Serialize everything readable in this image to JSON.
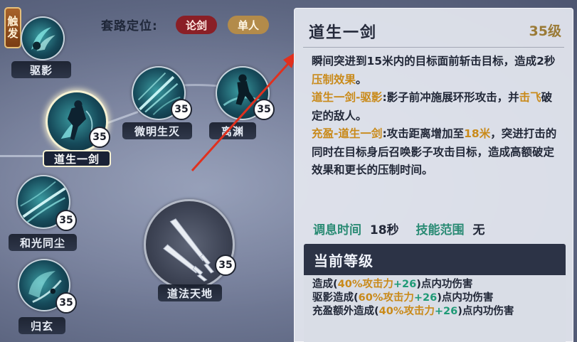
{
  "trigger_label": "触发",
  "route": {
    "label": "套路定位:",
    "tags": [
      "论剑",
      "单人"
    ]
  },
  "skills": [
    {
      "name": "驱影",
      "level": null
    },
    {
      "name": "道生一剑",
      "level": "35",
      "selected": true
    },
    {
      "name": "微明生灭",
      "level": "35"
    },
    {
      "name": "离渊",
      "level": "35"
    },
    {
      "name": "和光同尘",
      "level": "35"
    },
    {
      "name": "归玄",
      "level": "35"
    },
    {
      "name": "道法天地",
      "level": "35"
    }
  ],
  "detail": {
    "title": "道生一剑",
    "level": "35级",
    "desc": {
      "p1a": "瞬间突进到15米内的目标面前斩击目标，造成2秒",
      "p1b": "压制效果",
      "p1c": "。",
      "p2a": "道生一剑-驱影",
      "p2b": ":影子前冲施展环形攻击，并",
      "p2c": "击飞",
      "p2d": "破定的敌人。",
      "p3a": "充盈-道生一剑",
      "p3b": ":攻击距离增加至",
      "p3c": "18米",
      "p3d": "，突进打击的同时在目标身后召唤影子攻击目标，造成高额破定效果和更长的压制时间。"
    },
    "stats": {
      "cooldown_label": "调息时间",
      "cooldown_value": "18秒",
      "range_label": "技能范围",
      "range_value": "无"
    },
    "current": {
      "title": "当前等级",
      "l1a": "造成(",
      "l1b": "40%",
      "l1c": "攻击力",
      "l1d": "+26",
      "l1e": ")点内功伤害",
      "l2a": "驱影造成(",
      "l2b": "60%",
      "l2c": "攻击力",
      "l2d": "+26",
      "l2e": ")点内功伤害",
      "l3a": "充盈额外造成(",
      "l3b": "40%",
      "l3c": "攻击力",
      "l3d": "+26",
      "l3e": ")点内功伤害"
    }
  },
  "colors": {
    "accent_gold": "#c98a1a",
    "accent_green": "#1f9a76",
    "tag_red": "#8a1f26",
    "tag_gold": "#b38b4a",
    "arrow_red": "#e0301e"
  }
}
